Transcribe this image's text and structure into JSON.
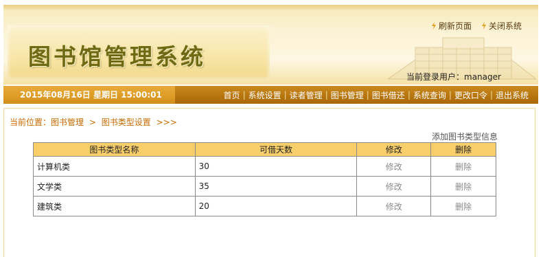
{
  "header": {
    "app_title": "图书馆管理系统",
    "top_links": [
      {
        "label": "刷新页面",
        "icon": "lightning-icon"
      },
      {
        "label": "关闭系统",
        "icon": "lightning-icon"
      }
    ],
    "login_user_label": "当前登录用户：manager"
  },
  "navbar": {
    "datetime": "2015年08月16日 星期日 15:00:01",
    "items": [
      "首页",
      "系统设置",
      "读者管理",
      "图书管理",
      "图书借还",
      "系统查询",
      "更改口令",
      "退出系统"
    ]
  },
  "breadcrumb": {
    "prefix": "当前位置：",
    "items": [
      "图书管理",
      "图书类型设置"
    ],
    "separator": ">",
    "suffix": ">>>"
  },
  "add_link": "添加图书类型信息",
  "table": {
    "headers": [
      "图书类型名称",
      "可借天数",
      "修改",
      "删除"
    ],
    "rows": [
      {
        "name": "计算机类",
        "days": "30",
        "edit": "修改",
        "delete": "删除"
      },
      {
        "name": "文学类",
        "days": "35",
        "edit": "修改",
        "delete": "删除"
      },
      {
        "name": "建筑类",
        "days": "20",
        "edit": "修改",
        "delete": "删除"
      }
    ]
  },
  "colors": {
    "nav_bar": "#b8760f",
    "date_box": "#de9b26",
    "table_header": "#f9cf6b",
    "breadcrumb": "#c76a00",
    "title": "#6e6a14"
  }
}
